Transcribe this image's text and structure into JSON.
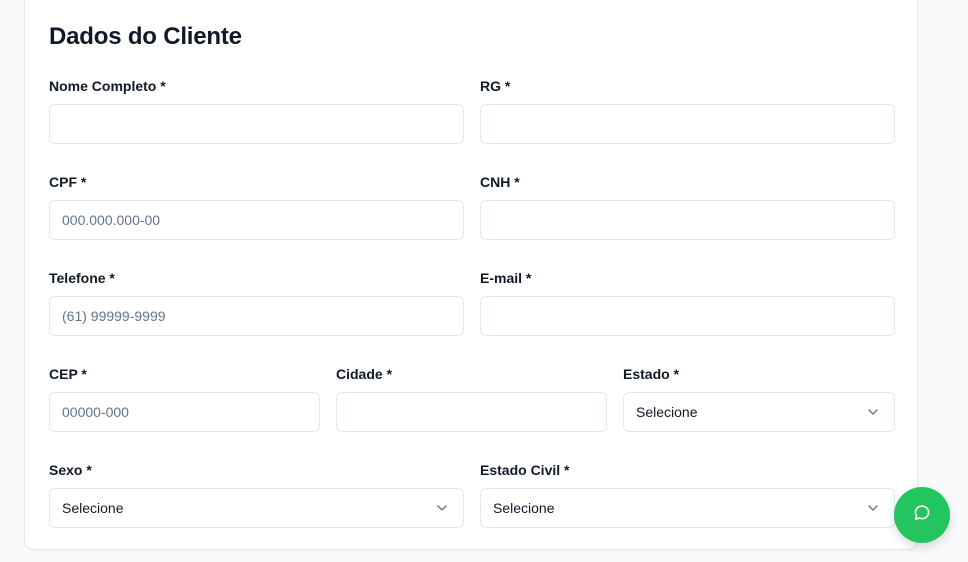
{
  "form": {
    "title": "Dados do Cliente",
    "fields": {
      "nome": {
        "label": "Nome Completo *",
        "value": "",
        "placeholder": ""
      },
      "rg": {
        "label": "RG *",
        "value": "",
        "placeholder": ""
      },
      "cpf": {
        "label": "CPF *",
        "value": "",
        "placeholder": "000.000.000-00"
      },
      "cnh": {
        "label": "CNH *",
        "value": "",
        "placeholder": ""
      },
      "telefone": {
        "label": "Telefone *",
        "value": "",
        "placeholder": "(61) 99999-9999"
      },
      "email": {
        "label": "E-mail *",
        "value": "",
        "placeholder": ""
      },
      "cep": {
        "label": "CEP *",
        "value": "",
        "placeholder": "00000-000"
      },
      "cidade": {
        "label": "Cidade *",
        "value": "",
        "placeholder": ""
      },
      "estado": {
        "label": "Estado *",
        "selected": "Selecione"
      },
      "sexo": {
        "label": "Sexo *",
        "selected": "Selecione"
      },
      "estado_civil": {
        "label": "Estado Civil *",
        "selected": "Selecione"
      }
    }
  },
  "chat_button": {
    "icon": "chat-bubble-icon",
    "color": "#22c55e"
  },
  "colors": {
    "border": "#e2e8f0",
    "placeholder": "#64748b",
    "text": "#111827",
    "accent": "#22c55e"
  }
}
